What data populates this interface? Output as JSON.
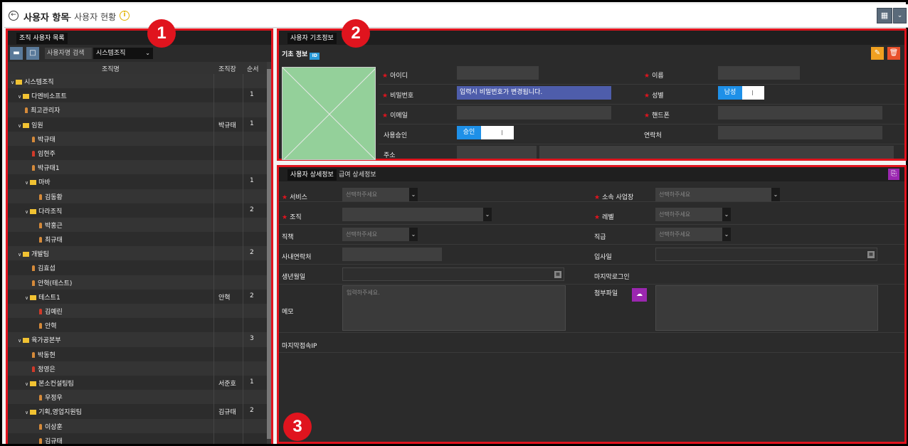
{
  "header": {
    "title": "사용자 항목",
    "subtitle": "- 사용자 현황",
    "info_glyph": "i"
  },
  "badges": [
    "1",
    "2",
    "3"
  ],
  "org_panel": {
    "tab": "조직 사용자 목록",
    "search_label": "사용자명 검색",
    "org_select": "시스템조직",
    "columns": {
      "name": "조직명",
      "head": "조직장",
      "order": "순서"
    },
    "rows": [
      {
        "level": 0,
        "type": "folder",
        "name": "시스템조직",
        "head": "",
        "order": ""
      },
      {
        "level": 1,
        "type": "folder",
        "name": "다엔비소프트",
        "head": "",
        "order": "1"
      },
      {
        "level": 2,
        "type": "person",
        "name": "최고관리자",
        "head": "",
        "order": ""
      },
      {
        "level": 1,
        "type": "folder",
        "name": "임원",
        "head": "박규태",
        "order": "1"
      },
      {
        "level": 3,
        "type": "person",
        "name": "박규태",
        "head": "",
        "order": ""
      },
      {
        "level": 3,
        "type": "person-red",
        "name": "임현주",
        "head": "",
        "order": ""
      },
      {
        "level": 3,
        "type": "person",
        "name": "박규태1",
        "head": "",
        "order": ""
      },
      {
        "level": 2,
        "type": "folder",
        "name": "마바",
        "head": "",
        "order": "1"
      },
      {
        "level": 4,
        "type": "person",
        "name": "김동황",
        "head": "",
        "order": ""
      },
      {
        "level": 2,
        "type": "folder",
        "name": "다라조직",
        "head": "",
        "order": "2"
      },
      {
        "level": 4,
        "type": "person",
        "name": "박홍근",
        "head": "",
        "order": ""
      },
      {
        "level": 4,
        "type": "person",
        "name": "최규태",
        "head": "",
        "order": ""
      },
      {
        "level": 1,
        "type": "folder",
        "name": "개발팀",
        "head": "",
        "order": "2"
      },
      {
        "level": 3,
        "type": "person",
        "name": "김효섭",
        "head": "",
        "order": ""
      },
      {
        "level": 3,
        "type": "person",
        "name": "안혁(테스트)",
        "head": "",
        "order": ""
      },
      {
        "level": 2,
        "type": "folder",
        "name": "테스트1",
        "head": "안혁",
        "order": "2"
      },
      {
        "level": 4,
        "type": "person-red",
        "name": "김예린",
        "head": "",
        "order": ""
      },
      {
        "level": 4,
        "type": "person",
        "name": "안혁",
        "head": "",
        "order": ""
      },
      {
        "level": 1,
        "type": "folder",
        "name": "육가공본부",
        "head": "",
        "order": "3"
      },
      {
        "level": 3,
        "type": "person",
        "name": "박동현",
        "head": "",
        "order": ""
      },
      {
        "level": 3,
        "type": "person-red",
        "name": "정영은",
        "head": "",
        "order": ""
      },
      {
        "level": 2,
        "type": "folder",
        "name": "본소컨설팅팀",
        "head": "서준호",
        "order": "1"
      },
      {
        "level": 4,
        "type": "person",
        "name": "우정우",
        "head": "",
        "order": ""
      },
      {
        "level": 2,
        "type": "folder",
        "name": "기획,영업지원팀",
        "head": "김규태",
        "order": "2"
      },
      {
        "level": 4,
        "type": "person",
        "name": "이상훈",
        "head": "",
        "order": ""
      },
      {
        "level": 4,
        "type": "person",
        "name": "김규태",
        "head": "",
        "order": ""
      }
    ]
  },
  "basic_panel": {
    "tab": "사용자 기초정보",
    "section": "기초 정보",
    "id_label": "아이디",
    "name_label": "이름",
    "password_label": "비밀번호",
    "password_value": "입력시 비밀번호가 변경됩니다.",
    "gender_label": "성별",
    "gender_value": "남성",
    "email_label": "이메일",
    "mobile_label": "핸드폰",
    "approve_label": "사용승인",
    "approve_value": "승인",
    "contact_label": "연락처",
    "address_label": "주소"
  },
  "detail_panel": {
    "tabs": [
      "사용자 상세정보",
      "급여 상세정보"
    ],
    "placeholder": "선택하주세요",
    "service_label": "서비스",
    "workplace_label": "소속 사업장",
    "org_label": "조직",
    "level_label": "레벨",
    "duty_label": "직책",
    "rank_label": "직급",
    "phone_label": "사내연락처",
    "join_label": "입사일",
    "birth_label": "생년월일",
    "lastlogin_label": "마지막로그인",
    "memo_label": "메모",
    "memo_placeholder": "입력하주세요.",
    "attach_label": "첨부파일",
    "lastip_label": "마지막접속IP"
  },
  "colors": {
    "frame_red": "#e0141e",
    "toggle_blue": "#1e90e8",
    "edit_orange": "#f0a020",
    "delete_red": "#e8502a",
    "purple": "#9b27b0",
    "password_field": "#4e5dab"
  }
}
